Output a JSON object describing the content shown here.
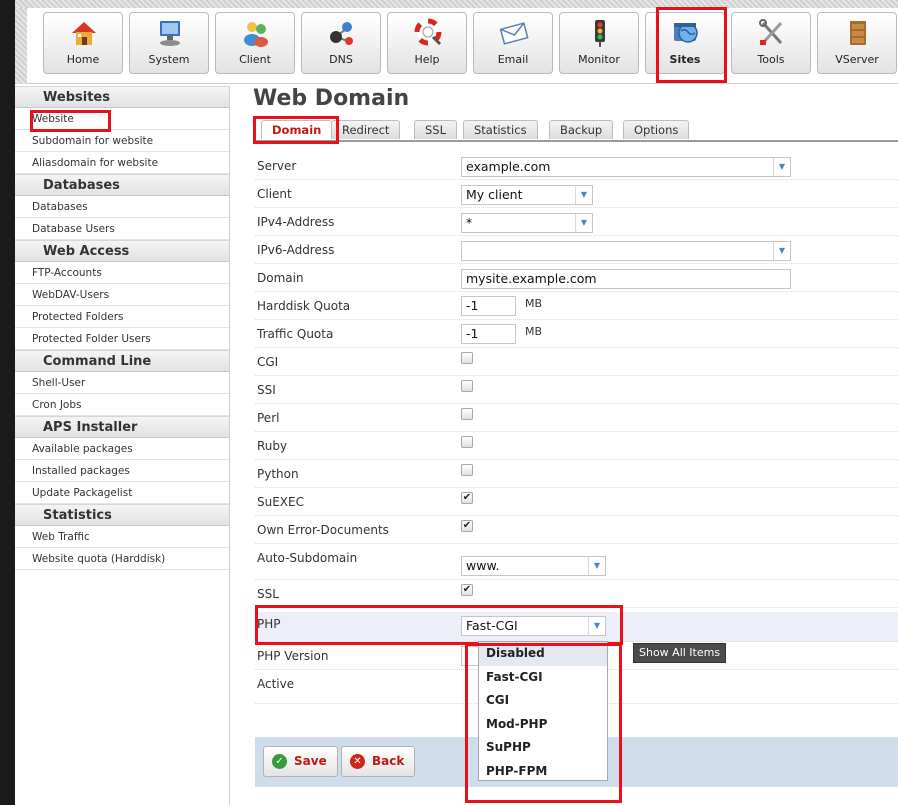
{
  "toolbar": {
    "items": [
      {
        "label": "Home",
        "icon": "home-icon"
      },
      {
        "label": "System",
        "icon": "computer-icon"
      },
      {
        "label": "Client",
        "icon": "users-icon"
      },
      {
        "label": "DNS",
        "icon": "dns-molecule-icon"
      },
      {
        "label": "Help",
        "icon": "lifebuoy-icon"
      },
      {
        "label": "Email",
        "icon": "envelope-icon"
      },
      {
        "label": "Monitor",
        "icon": "traffic-light-icon"
      },
      {
        "label": "Sites",
        "icon": "globe-window-icon",
        "active": true
      },
      {
        "label": "Tools",
        "icon": "wrench-screwdriver-icon"
      },
      {
        "label": "VServer",
        "icon": "cabinet-icon"
      }
    ]
  },
  "sidebar": {
    "sections": [
      {
        "title": "Websites",
        "items": [
          "Website",
          "Subdomain for website",
          "Aliasdomain for website"
        ]
      },
      {
        "title": "Databases",
        "items": [
          "Databases",
          "Database Users"
        ]
      },
      {
        "title": "Web Access",
        "items": [
          "FTP-Accounts",
          "WebDAV-Users",
          "Protected Folders",
          "Protected Folder Users"
        ]
      },
      {
        "title": "Command Line",
        "items": [
          "Shell-User",
          "Cron Jobs"
        ]
      },
      {
        "title": "APS Installer",
        "items": [
          "Available packages",
          "Installed packages",
          "Update Packagelist"
        ]
      },
      {
        "title": "Statistics",
        "items": [
          "Web Traffic",
          "Website quota (Harddisk)"
        ]
      }
    ]
  },
  "main": {
    "title": "Web Domain",
    "tabs": [
      "Domain",
      "Redirect",
      "SSL",
      "Statistics",
      "Backup",
      "Options"
    ],
    "active_tab": "Domain",
    "form": {
      "server": {
        "label": "Server",
        "value": "example.com"
      },
      "client": {
        "label": "Client",
        "value": "My client"
      },
      "ipv4": {
        "label": "IPv4-Address",
        "value": "*"
      },
      "ipv6": {
        "label": "IPv6-Address",
        "value": ""
      },
      "domain": {
        "label": "Domain",
        "value": "mysite.example.com"
      },
      "hd_quota": {
        "label": "Harddisk Quota",
        "value": "-1",
        "unit": "MB"
      },
      "traffic_quota": {
        "label": "Traffic Quota",
        "value": "-1",
        "unit": "MB"
      },
      "cgi": {
        "label": "CGI",
        "checked": false
      },
      "ssi": {
        "label": "SSI",
        "checked": false
      },
      "perl": {
        "label": "Perl",
        "checked": false
      },
      "ruby": {
        "label": "Ruby",
        "checked": false
      },
      "python": {
        "label": "Python",
        "checked": false
      },
      "suexec": {
        "label": "SuEXEC",
        "checked": true
      },
      "own_error": {
        "label": "Own Error-Documents",
        "checked": true
      },
      "auto_subdomain": {
        "label": "Auto-Subdomain",
        "value": "www."
      },
      "ssl": {
        "label": "SSL",
        "checked": true
      },
      "php": {
        "label": "PHP",
        "value": "Fast-CGI"
      },
      "php_version": {
        "label": "PHP Version"
      },
      "active": {
        "label": "Active"
      }
    },
    "php_options": [
      "Disabled",
      "Fast-CGI",
      "CGI",
      "Mod-PHP",
      "SuPHP",
      "PHP-FPM"
    ],
    "tooltip": "Show All Items",
    "buttons": {
      "save": "Save",
      "back": "Back"
    }
  },
  "colors": {
    "highlight": "#e8101a",
    "active_tab_text": "#c2180e",
    "button_bar": "#cfddea",
    "select_arrow": "#4a89c6"
  }
}
